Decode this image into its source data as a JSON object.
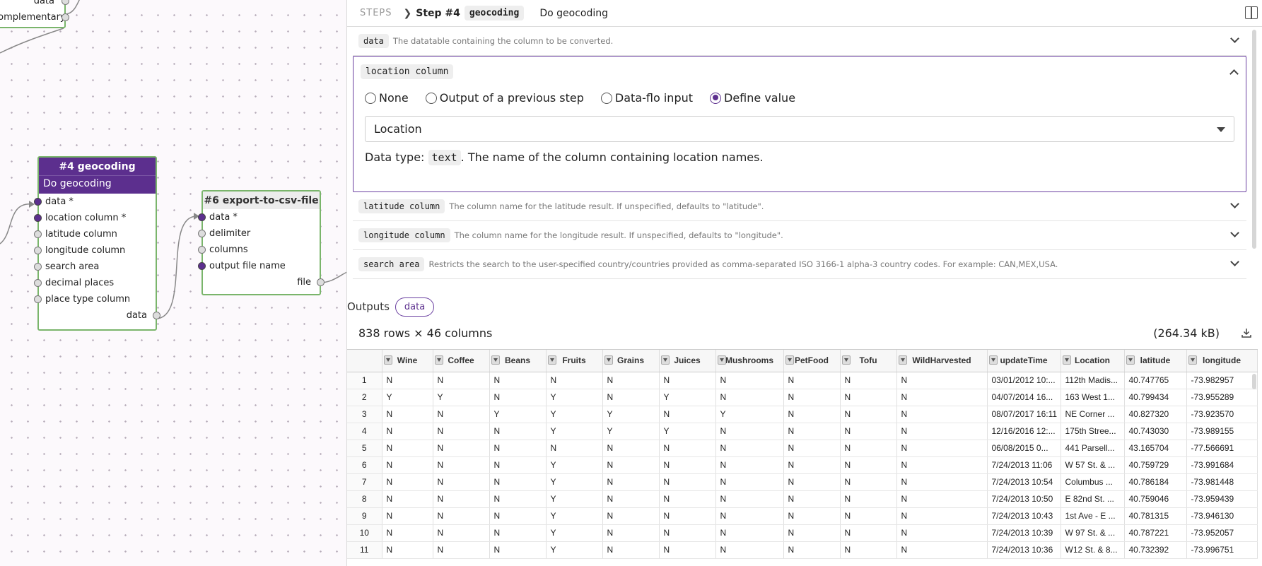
{
  "canvas": {
    "fragment_node": {
      "ports": [
        "data",
        "complementary"
      ]
    },
    "geocoding_node": {
      "title": "#4 geocoding",
      "subtitle": "Do geocoding",
      "inputs": [
        {
          "label": "data *",
          "filled": true
        },
        {
          "label": "location column *",
          "filled": true
        },
        {
          "label": "latitude column",
          "filled": false
        },
        {
          "label": "longitude column",
          "filled": false
        },
        {
          "label": "search area",
          "filled": false
        },
        {
          "label": "decimal places",
          "filled": false
        },
        {
          "label": "place type column",
          "filled": false
        }
      ],
      "output": "data"
    },
    "export_node": {
      "title": "#6 export-to-csv-file",
      "inputs": [
        {
          "label": "data *",
          "filled": true
        },
        {
          "label": "delimiter",
          "filled": false
        },
        {
          "label": "columns",
          "filled": false
        },
        {
          "label": "output file name",
          "filled": true
        }
      ],
      "output": "file"
    }
  },
  "header": {
    "steps_label": "STEPS",
    "step_number": "Step #4",
    "step_code": "geocoding",
    "step_title": "Do geocoding"
  },
  "params": {
    "data": {
      "name": "data",
      "desc": "The datatable containing the column to be converted."
    },
    "location": {
      "name": "location column",
      "options": [
        "None",
        "Output of a previous step",
        "Data-flo input",
        "Define value"
      ],
      "selected": "Define value",
      "value": "Location",
      "dtype_prefix": "Data type:",
      "dtype": "text",
      "dtype_desc": ".  The name of the column containing location names."
    },
    "latitude": {
      "name": "latitude column",
      "desc": "The column name for the latitude result. If unspecified, defaults to \"latitude\"."
    },
    "longitude": {
      "name": "longitude column",
      "desc": "The column name for the longitude result. If unspecified, defaults to \"longitude\"."
    },
    "search_area": {
      "name": "search area",
      "desc": "Restricts the search to the user-specified country/countries provided as comma-separated ISO 3166-1 alpha-3 country codes. For example: CAN,MEX,USA."
    }
  },
  "outputs": {
    "label": "Outputs",
    "pill": "data",
    "rows_info": "838 rows × 46 columns",
    "size": "(264.34 kB)"
  },
  "table": {
    "columns": [
      "Wine",
      "Coffee",
      "Beans",
      "Fruits",
      "Grains",
      "Juices",
      "Mushrooms",
      "PetFood",
      "Tofu",
      "WildHarvested",
      "updateTime",
      "Location",
      "latitude",
      "longitude"
    ],
    "rows": [
      [
        "1",
        "N",
        "N",
        "N",
        "N",
        "N",
        "N",
        "N",
        "N",
        "N",
        "N",
        "03/01/2012 10:...",
        "112th Madis...",
        "40.747765",
        "-73.982957"
      ],
      [
        "2",
        "Y",
        "Y",
        "N",
        "Y",
        "N",
        "Y",
        "N",
        "N",
        "N",
        "N",
        "04/07/2014 16...",
        "163 West 1...",
        "40.799434",
        "-73.955289"
      ],
      [
        "3",
        "N",
        "N",
        "Y",
        "Y",
        "Y",
        "N",
        "Y",
        "N",
        "N",
        "N",
        "08/07/2017 16:11",
        "NE Corner ...",
        "40.827320",
        "-73.923570"
      ],
      [
        "4",
        "N",
        "N",
        "N",
        "Y",
        "Y",
        "Y",
        "N",
        "N",
        "N",
        "N",
        "12/16/2016 12:...",
        "175th Stree...",
        "40.743030",
        "-73.989155"
      ],
      [
        "5",
        "N",
        "N",
        "N",
        "N",
        "N",
        "N",
        "N",
        "N",
        "N",
        "N",
        "06/08/2015 0...",
        "441 Parsell...",
        "43.165704",
        "-77.566691"
      ],
      [
        "6",
        "N",
        "N",
        "N",
        "Y",
        "N",
        "N",
        "N",
        "N",
        "N",
        "N",
        "7/24/2013 11:06",
        "W 57 St. & ...",
        "40.759729",
        "-73.991684"
      ],
      [
        "7",
        "N",
        "N",
        "N",
        "Y",
        "N",
        "N",
        "N",
        "N",
        "N",
        "N",
        "7/24/2013 10:54",
        "Columbus ...",
        "40.786184",
        "-73.981448"
      ],
      [
        "8",
        "N",
        "N",
        "N",
        "Y",
        "N",
        "N",
        "N",
        "N",
        "N",
        "N",
        "7/24/2013 10:50",
        "E 82nd St. ...",
        "40.759046",
        "-73.959439"
      ],
      [
        "9",
        "N",
        "N",
        "N",
        "Y",
        "N",
        "N",
        "N",
        "N",
        "N",
        "N",
        "7/24/2013 10:43",
        "1st Ave - E ...",
        "40.781315",
        "-73.946130"
      ],
      [
        "10",
        "N",
        "N",
        "N",
        "Y",
        "N",
        "N",
        "N",
        "N",
        "N",
        "N",
        "7/24/2013 10:39",
        "W 97 St. & ...",
        "40.787221",
        "-73.952057"
      ],
      [
        "11",
        "N",
        "N",
        "N",
        "Y",
        "N",
        "N",
        "N",
        "N",
        "N",
        "N",
        "7/24/2013 10:36",
        "W12 St. & 8...",
        "40.732392",
        "-73.996751"
      ]
    ]
  }
}
